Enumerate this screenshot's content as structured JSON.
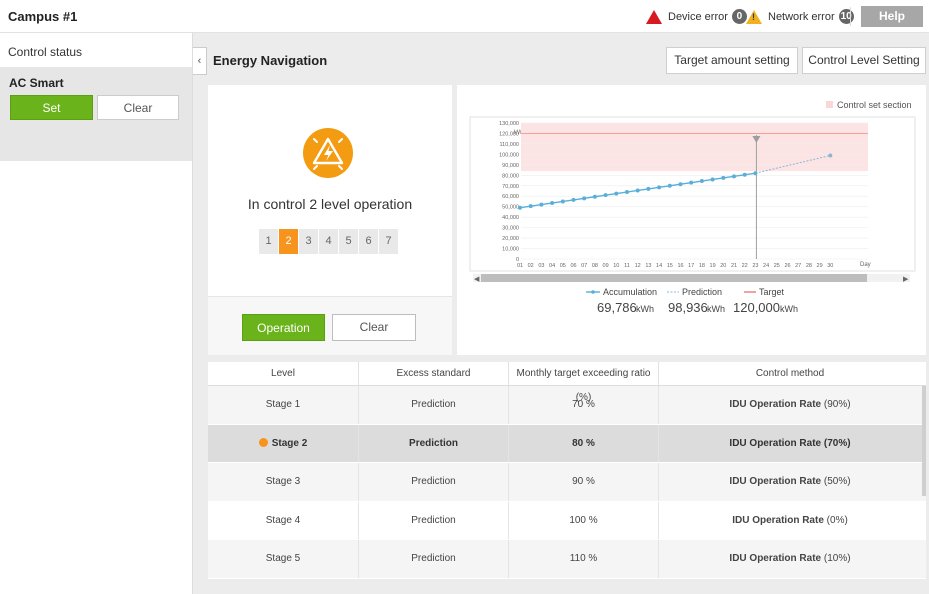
{
  "header": {
    "title": "Campus #1",
    "device_error_label": "Device error",
    "device_error_count": "0",
    "network_error_label": "Network error",
    "network_error_count": "10",
    "help_label": "Help"
  },
  "sidebar": {
    "title": "Control status",
    "sub_title": "AC Smart",
    "set_label": "Set",
    "clear_label": "Clear"
  },
  "main": {
    "title": "Energy Navigation",
    "target_setting_label": "Target amount setting",
    "level_setting_label": "Control Level Setting",
    "operation_text": "In control 2 level operation",
    "levels": [
      "1",
      "2",
      "3",
      "4",
      "5",
      "6",
      "7"
    ],
    "active_level": 2,
    "operation_label": "Operation",
    "clear_label": "Clear",
    "icon": "energy-warning-icon"
  },
  "chart": {
    "legend_section": "Control set section",
    "unit_y": "kWh",
    "unit_x": "Day",
    "series_labels": {
      "accumulation": "Accumulation",
      "prediction": "Prediction",
      "target": "Target"
    },
    "summary": {
      "accumulation_value": "69,786",
      "prediction_value": "98,936",
      "target_value": "120,000",
      "unit": "kWh"
    },
    "colors": {
      "accumulation": "#5aafd8",
      "prediction": "#8fb4d6",
      "target": "#f2a09a",
      "section": "#fde4e4"
    }
  },
  "chart_data": {
    "type": "line",
    "xlabel": "Day",
    "ylabel": "kWh",
    "categories": [
      "01",
      "02",
      "03",
      "04",
      "05",
      "06",
      "07",
      "08",
      "09",
      "10",
      "11",
      "12",
      "13",
      "14",
      "15",
      "16",
      "17",
      "18",
      "19",
      "20",
      "21",
      "22",
      "23",
      "24",
      "25",
      "26",
      "27",
      "28",
      "29",
      "30"
    ],
    "y_ticks": [
      "0",
      "10,000",
      "20,000",
      "30,000",
      "40,000",
      "50,000",
      "60,000",
      "70,000",
      "80,000",
      "90,000",
      "100,000",
      "110,000",
      "120,000",
      "130,000"
    ],
    "ylim": [
      0,
      130000
    ],
    "series": [
      {
        "name": "Accumulation",
        "x": [
          "01",
          "02",
          "03",
          "04",
          "05",
          "06",
          "07",
          "08",
          "09",
          "10",
          "11",
          "12",
          "13",
          "14",
          "15",
          "16",
          "17",
          "18",
          "19",
          "20",
          "21",
          "22",
          "23"
        ],
        "values": [
          49000,
          50500,
          52000,
          53500,
          55000,
          56500,
          58000,
          59500,
          61000,
          62500,
          64000,
          65500,
          67000,
          68500,
          70000,
          71500,
          73000,
          74500,
          76000,
          77500,
          79000,
          80500,
          82000
        ]
      },
      {
        "name": "Prediction",
        "x": [
          "23",
          "30"
        ],
        "values": [
          82000,
          98936
        ]
      },
      {
        "name": "Target",
        "x": [
          "01",
          "30"
        ],
        "values": [
          120000,
          120000
        ]
      }
    ],
    "control_set_section": [
      84000,
      130000
    ],
    "marker_day": "23",
    "grid": true
  },
  "table": {
    "headers": [
      "Level",
      "Excess standard",
      "Monthly target exceeding ratio (%)",
      "Control method"
    ],
    "rows": [
      {
        "level": "Stage 1",
        "standard": "Prediction",
        "ratio": "70 %",
        "method": "IDU Operation Rate",
        "method_value": "(90%)",
        "active": false
      },
      {
        "level": "Stage 2",
        "standard": "Prediction",
        "ratio": "80 %",
        "method": "IDU Operation Rate",
        "method_value": "(70%)",
        "active": true
      },
      {
        "level": "Stage 3",
        "standard": "Prediction",
        "ratio": "90 %",
        "method": "IDU Operation Rate",
        "method_value": "(50%)",
        "active": false
      },
      {
        "level": "Stage 4",
        "standard": "Prediction",
        "ratio": "100 %",
        "method": "IDU Operation Rate",
        "method_value": "(0%)",
        "active": false
      },
      {
        "level": "Stage 5",
        "standard": "Prediction",
        "ratio": "110 %",
        "method": "IDU Operation Rate",
        "method_value": "(10%)",
        "active": false
      }
    ]
  }
}
